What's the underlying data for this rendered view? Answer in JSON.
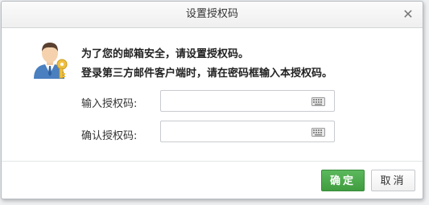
{
  "dialog": {
    "title": "设置授权码",
    "close_symbol": "✕"
  },
  "message": {
    "line1": "为了您的邮箱安全，请设置授权码。",
    "line2": "登录第三方邮件客户端时，请在密码框输入本授权码。"
  },
  "form": {
    "auth_code_label": "输入授权码:",
    "auth_code_value": "",
    "confirm_code_label": "确认授权码:",
    "confirm_code_value": ""
  },
  "buttons": {
    "ok_label": "确定",
    "cancel_label": "取消"
  },
  "icons": {
    "avatar": "user-with-key-icon",
    "keyboard": "keyboard-icon"
  },
  "colors": {
    "primary_green": "#4cae4c"
  }
}
